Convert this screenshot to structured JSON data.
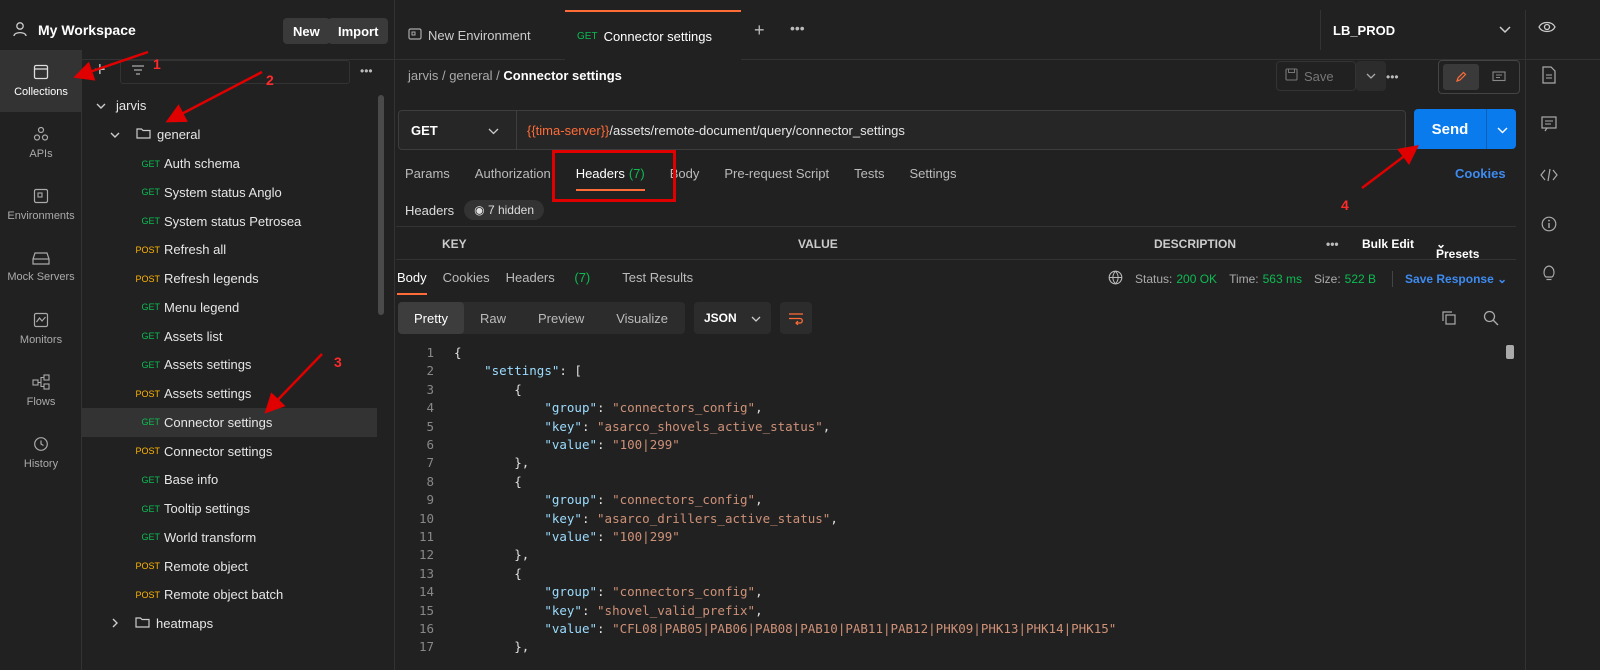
{
  "workspace": {
    "title": "My Workspace",
    "new_label": "New",
    "import_label": "Import"
  },
  "tabs": [
    {
      "label": "New Environment"
    },
    {
      "method": "GET",
      "label": "Connector settings"
    }
  ],
  "environment": {
    "selected": "LB_PROD"
  },
  "rail": [
    {
      "label": "Collections",
      "icon": "collections-icon"
    },
    {
      "label": "APIs",
      "icon": "apis-icon"
    },
    {
      "label": "Environments",
      "icon": "environments-icon"
    },
    {
      "label": "Mock Servers",
      "icon": "mock-servers-icon"
    },
    {
      "label": "Monitors",
      "icon": "monitors-icon"
    },
    {
      "label": "Flows",
      "icon": "flows-icon"
    },
    {
      "label": "History",
      "icon": "history-icon"
    }
  ],
  "tree": {
    "root": "jarvis",
    "folder": "general",
    "items": [
      {
        "method": "GET",
        "label": "Auth schema"
      },
      {
        "method": "GET",
        "label": "System status Anglo"
      },
      {
        "method": "GET",
        "label": "System status Petrosea"
      },
      {
        "method": "POST",
        "label": "Refresh all"
      },
      {
        "method": "POST",
        "label": "Refresh legends"
      },
      {
        "method": "GET",
        "label": "Menu legend"
      },
      {
        "method": "GET",
        "label": "Assets list"
      },
      {
        "method": "GET",
        "label": "Assets settings"
      },
      {
        "method": "POST",
        "label": "Assets settings"
      },
      {
        "method": "GET",
        "label": "Connector settings"
      },
      {
        "method": "POST",
        "label": "Connector settings"
      },
      {
        "method": "GET",
        "label": "Base info"
      },
      {
        "method": "GET",
        "label": "Tooltip settings"
      },
      {
        "method": "GET",
        "label": "World transform"
      },
      {
        "method": "POST",
        "label": "Remote object"
      },
      {
        "method": "POST",
        "label": "Remote object batch"
      }
    ],
    "folder2": "heatmaps"
  },
  "breadcrumb": {
    "p1": "jarvis",
    "p2": "general",
    "current": "Connector settings",
    "save_label": "Save"
  },
  "request": {
    "method": "GET",
    "url_var": "{{tima-server}}",
    "url_path": "/assets/remote-document/query/connector_settings",
    "send_label": "Send"
  },
  "req_tabs": {
    "params": "Params",
    "authorization": "Authorization",
    "headers": "Headers",
    "headers_count": "(7)",
    "body": "Body",
    "prerequest": "Pre-request Script",
    "tests": "Tests",
    "settings": "Settings",
    "cookies": "Cookies"
  },
  "headers_section": {
    "label": "Headers",
    "hidden": "7 hidden"
  },
  "kv_table": {
    "key": "KEY",
    "value": "VALUE",
    "description": "DESCRIPTION",
    "bulk_edit": "Bulk Edit",
    "presets": "Presets"
  },
  "response": {
    "tabs": {
      "body": "Body",
      "cookies": "Cookies",
      "headers": "Headers",
      "headers_count": "(7)",
      "tests": "Test Results"
    },
    "status_label": "Status:",
    "status": "200 OK",
    "time_label": "Time:",
    "time": "563 ms",
    "size_label": "Size:",
    "size": "522 B",
    "save_response": "Save Response",
    "views": {
      "pretty": "Pretty",
      "raw": "Raw",
      "preview": "Preview",
      "visualize": "Visualize"
    },
    "format": "JSON"
  },
  "code": [
    {
      "n": "1",
      "t": "{"
    },
    {
      "n": "2",
      "t": "    \"settings\": ["
    },
    {
      "n": "3",
      "t": "        {"
    },
    {
      "n": "4",
      "t": "            \"group\": \"connectors_config\","
    },
    {
      "n": "5",
      "t": "            \"key\": \"asarco_shovels_active_status\","
    },
    {
      "n": "6",
      "t": "            \"value\": \"100|299\""
    },
    {
      "n": "7",
      "t": "        },"
    },
    {
      "n": "8",
      "t": "        {"
    },
    {
      "n": "9",
      "t": "            \"group\": \"connectors_config\","
    },
    {
      "n": "10",
      "t": "            \"key\": \"asarco_drillers_active_status\","
    },
    {
      "n": "11",
      "t": "            \"value\": \"100|299\""
    },
    {
      "n": "12",
      "t": "        },"
    },
    {
      "n": "13",
      "t": "        {"
    },
    {
      "n": "14",
      "t": "            \"group\": \"connectors_config\","
    },
    {
      "n": "15",
      "t": "            \"key\": \"shovel_valid_prefix\","
    },
    {
      "n": "16",
      "t": "            \"value\": \"CFL08|PAB05|PAB06|PAB08|PAB10|PAB11|PAB12|PHK09|PHK13|PHK14|PHK15\""
    },
    {
      "n": "17",
      "t": "        },"
    }
  ],
  "annotations": [
    "1",
    "2",
    "3",
    "4"
  ]
}
